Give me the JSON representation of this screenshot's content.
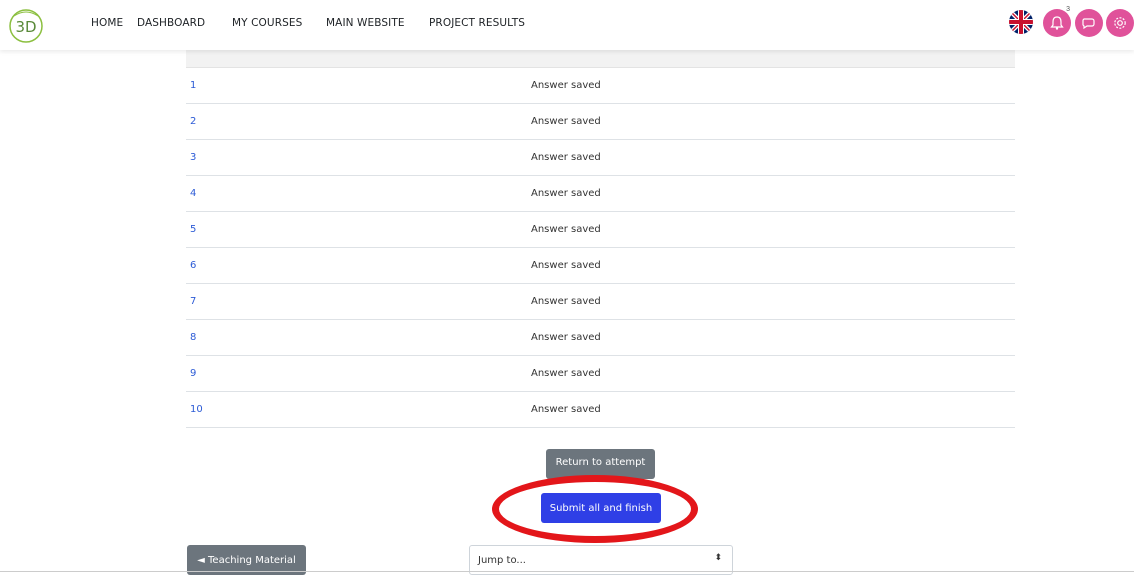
{
  "nav": {
    "logo_text": "3D",
    "links": [
      "HOME",
      "DASHBOARD",
      "MY COURSES",
      "MAIN WEBSITE",
      "PROJECT RESULTS"
    ],
    "notification_count": "3"
  },
  "summary": {
    "rows": [
      {
        "num": "1",
        "status": "Answer saved"
      },
      {
        "num": "2",
        "status": "Answer saved"
      },
      {
        "num": "3",
        "status": "Answer saved"
      },
      {
        "num": "4",
        "status": "Answer saved"
      },
      {
        "num": "5",
        "status": "Answer saved"
      },
      {
        "num": "6",
        "status": "Answer saved"
      },
      {
        "num": "7",
        "status": "Answer saved"
      },
      {
        "num": "8",
        "status": "Answer saved"
      },
      {
        "num": "9",
        "status": "Answer saved"
      },
      {
        "num": "10",
        "status": "Answer saved"
      }
    ]
  },
  "actions": {
    "return_label": "Return to attempt",
    "submit_label": "Submit all and finish"
  },
  "footer_nav": {
    "prev_label": "◄ Teaching Material",
    "jump_placeholder": "Jump to..."
  },
  "colors": {
    "accent_pink": "#e0529a",
    "submit_blue": "#2f3fe6",
    "annotation_red": "#e3161a"
  }
}
